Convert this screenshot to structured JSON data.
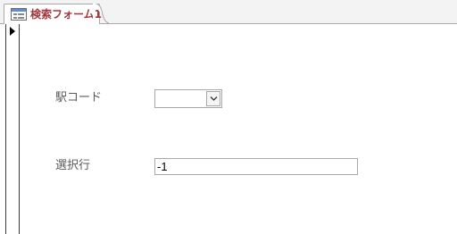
{
  "tab": {
    "title": "検索フォーム1",
    "icon": "form-icon"
  },
  "form": {
    "station_code_label": "駅コード",
    "station_code_value": "",
    "selected_row_label": "選択行",
    "selected_row_value": "-1"
  },
  "colors": {
    "tab_title": "#a4373a",
    "label": "#595959",
    "border": "#a9a9a9"
  }
}
